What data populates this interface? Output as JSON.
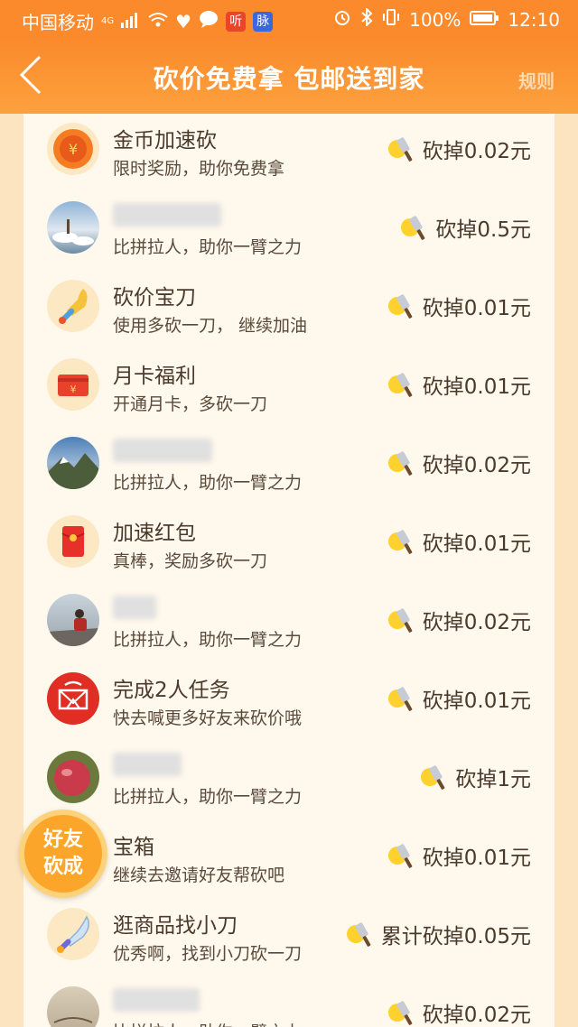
{
  "status_bar": {
    "carrier": "中国移动",
    "net_type": "4G",
    "app_badge_1": "听",
    "app_badge_2": "脉",
    "battery": "100%",
    "time": "12:10"
  },
  "header": {
    "title": "砍价免费拿 包邮送到家",
    "rules_label": "规则"
  },
  "rows": [
    {
      "title": "金币加速砍",
      "subtitle": "限时奖励，助你免费拿",
      "amount": "砍掉0.02元"
    },
    {
      "title": "",
      "subtitle": "比拼拉人，助你一臂之力",
      "amount": "砍掉0.5元"
    },
    {
      "title": "砍价宝刀",
      "subtitle": "使用多砍一刀， 继续加油",
      "amount": "砍掉0.01元"
    },
    {
      "title": "月卡福利",
      "subtitle": "开通月卡，多砍一刀",
      "amount": "砍掉0.01元"
    },
    {
      "title": "",
      "subtitle": "比拼拉人，助你一臂之力",
      "amount": "砍掉0.02元"
    },
    {
      "title": "加速红包",
      "subtitle": "真棒，奖励多砍一刀",
      "amount": "砍掉0.01元"
    },
    {
      "title": "",
      "subtitle": "比拼拉人，助你一臂之力",
      "amount": "砍掉0.02元"
    },
    {
      "title": "完成2人任务",
      "subtitle": "快去喊更多好友来砍价哦",
      "amount": "砍掉0.01元"
    },
    {
      "title": "",
      "subtitle": "比拼拉人，助你一臂之力",
      "amount": "砍掉1元"
    },
    {
      "title": "宝箱",
      "subtitle": "继续去邀请好友帮砍吧",
      "amount": "砍掉0.01元"
    },
    {
      "title": "逛商品找小刀",
      "subtitle": "优秀啊，找到小刀砍一刀",
      "amount": "累计砍掉0.05元"
    },
    {
      "title": "",
      "subtitle": "比拼拉人，助你一臂之力",
      "amount": "砍掉0.02元"
    }
  ],
  "float_button": {
    "line1": "好友",
    "line2": "砍成"
  },
  "colors": {
    "header_orange": "#fb8a2c",
    "panel_bg": "#fff8ec",
    "float_orange": "#fba62a"
  },
  "icons": [
    "back-arrow-icon",
    "coin-icon",
    "sword-icon",
    "red-envelope-icon",
    "pinduoduo-logo-icon",
    "treasure-box-icon",
    "knife-icon"
  ]
}
